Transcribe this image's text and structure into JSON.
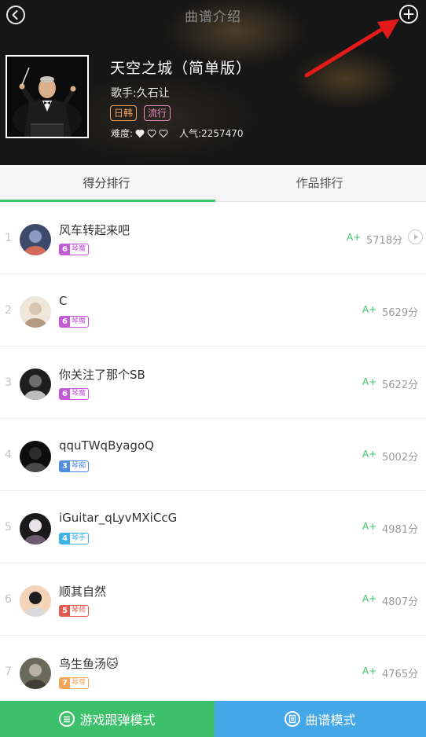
{
  "header": {
    "title": "曲谱介绍",
    "song_title": "天空之城（简单版）",
    "singer": "歌手:久石让",
    "tags": [
      "日韩",
      "流行"
    ],
    "difficulty_label": "难度:",
    "difficulty_level": 1,
    "difficulty_max": 3,
    "popularity": "人气:2257470"
  },
  "tabs": [
    {
      "label": "得分排行",
      "active": true
    },
    {
      "label": "作品排行",
      "active": false
    }
  ],
  "ranking": [
    {
      "rank": "1",
      "name": "风车转起来吧",
      "level": "6",
      "title": "琴魔",
      "grade": "A+",
      "score": "5718分",
      "play": true
    },
    {
      "rank": "2",
      "name": "C",
      "level": "6",
      "title": "琴魔",
      "grade": "A+",
      "score": "5629分",
      "play": false
    },
    {
      "rank": "3",
      "name": "你关注了那个SB",
      "level": "6",
      "title": "琴魔",
      "grade": "A+",
      "score": "5622分",
      "play": false
    },
    {
      "rank": "4",
      "name": "qquTWqByagoQ",
      "level": "3",
      "title": "琴痴",
      "grade": "A+",
      "score": "5002分",
      "play": false
    },
    {
      "rank": "5",
      "name": "iGuitar_qLyvMXiCcG",
      "level": "4",
      "title": "琴手",
      "grade": "A+",
      "score": "4981分",
      "play": false
    },
    {
      "rank": "6",
      "name": "顺其自然",
      "level": "5",
      "title": "琴师",
      "grade": "A+",
      "score": "4807分",
      "play": false
    },
    {
      "rank": "7",
      "name": "鸟生鱼汤🐱",
      "level": "7",
      "title": "琴尊",
      "grade": "A+",
      "score": "4765分",
      "play": false
    }
  ],
  "bottom": {
    "game_mode": "游戏跟弹模式",
    "score_mode": "曲谱模式"
  },
  "colors": {
    "accent_green": "#3cc36a",
    "blue_button": "#44a7e8",
    "level_6": "#c25ad6",
    "level_3": "#4f8be0",
    "level_4": "#3fb3e6",
    "level_5": "#e05a4f",
    "level_7": "#f2a65a"
  },
  "icons": {
    "back": "back-circle-icon",
    "add": "add-circle-icon",
    "play": "play-circle-icon",
    "heart": "heart-icon"
  }
}
